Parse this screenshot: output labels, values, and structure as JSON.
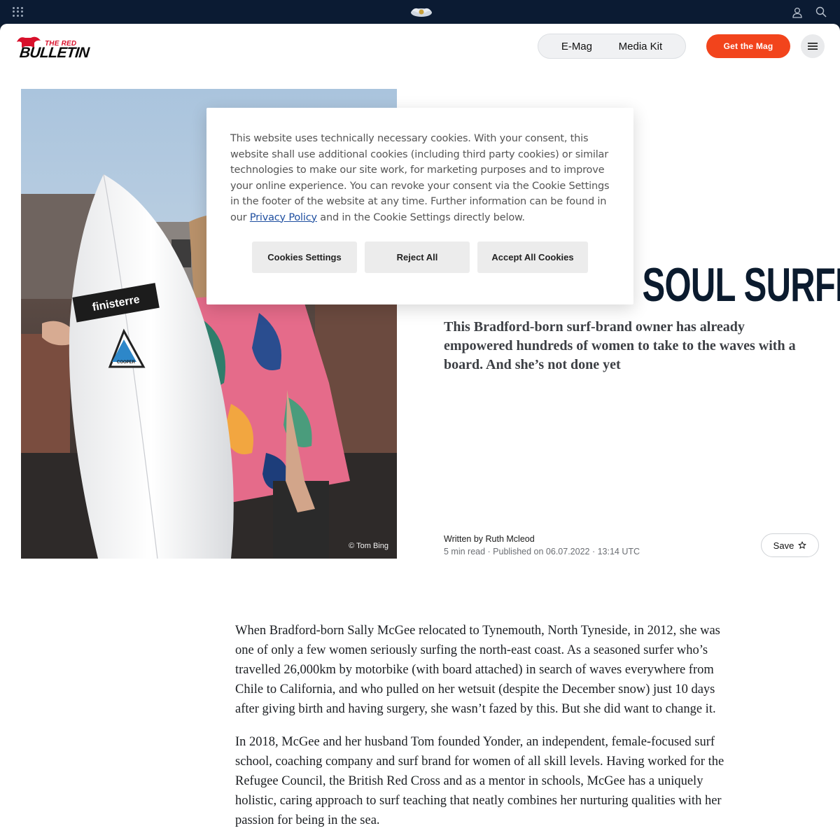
{
  "topbar": {
    "apps_icon": "apps-grid-icon",
    "logo_icon": "red-bull-logo-icon",
    "user_icon": "user-icon",
    "search_icon": "search-icon"
  },
  "header": {
    "brand_small": "THE RED",
    "brand_large": "BULLETIN",
    "nav": [
      "E-Mag",
      "Media Kit"
    ],
    "cta_label": "Get the Mag",
    "menu_icon": "hamburger-menu-icon"
  },
  "hero": {
    "credit": "© Tom Bing",
    "board_sticker": "finisterre",
    "board_logo": "COOPER"
  },
  "article": {
    "title": "NORTHERN SOUL SURFER",
    "subtitle": "This Bradford-born surf-brand owner has already empowered hundreds of women to take to the waves with a board. And she’s not done yet",
    "byline": "Written by Ruth Mcleod",
    "meta": "5 min read · Published on 06.07.2022 · 13:14 UTC",
    "save_label": "Save",
    "paragraphs": [
      "When Bradford-born Sally McGee relocated to Tynemouth, North Tyneside, in 2012, she was one of only a few women seriously surfing the north-east coast. As a seasoned surfer who’s travelled 26,000km by motorbike (with board attached) in search of waves everywhere from Chile to California, and who pulled on her wetsuit (despite the December snow) just 10 days after giving birth and having surgery, she wasn’t fazed by this. But she did want to change it.",
      "In 2018, McGee and her husband Tom founded Yonder, an independent, female-focused surf school, coaching company and surf brand for women of all skill levels. Having worked for the Refugee Council, the British Red Cross and as a mentor in schools, McGee has a uniquely holistic, caring approach to surf teaching that neatly combines her nurturing qualities with her passion for being in the sea."
    ]
  },
  "cookie": {
    "text_before_link": "This website uses technically necessary cookies. With your consent, this website shall use additional cookies (including third party cookies) or similar technologies to make our site work, for marketing purposes and to improve your online experience. You can revoke your consent via the Cookie Settings in the footer of the website at any time. Further information can be found in our ",
    "link_text": "Privacy Policy",
    "text_after_link": " and in the Cookie Settings directly below.",
    "buttons": {
      "settings": "Cookies Settings",
      "reject": "Reject All",
      "accept": "Accept All Cookies"
    }
  },
  "colors": {
    "topbar_bg": "#0b1b33",
    "cta_bg": "#f2441c",
    "brand_red": "#d8102b",
    "title_ink": "#0b1b2e",
    "link_blue": "#1f4fa0"
  }
}
